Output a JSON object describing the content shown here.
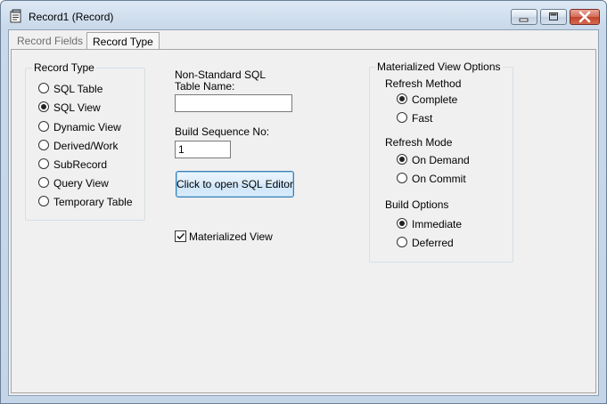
{
  "window": {
    "title": "Record1 (Record)"
  },
  "tabs": [
    {
      "label": "Record Fields",
      "selected": false
    },
    {
      "label": "Record Type",
      "selected": true
    }
  ],
  "record_type": {
    "legend": "Record Type",
    "options": [
      {
        "label": "SQL Table",
        "checked": false
      },
      {
        "label": "SQL View",
        "checked": true
      },
      {
        "label": "Dynamic View",
        "checked": false
      },
      {
        "label": "Derived/Work",
        "checked": false
      },
      {
        "label": "SubRecord",
        "checked": false
      },
      {
        "label": "Query View",
        "checked": false
      },
      {
        "label": "Temporary Table",
        "checked": false
      }
    ]
  },
  "middle": {
    "table_name_label_1": "Non-Standard SQL",
    "table_name_label_2": "Table Name:",
    "table_name_value": "",
    "build_seq_label": "Build Sequence No:",
    "build_seq_value": "1",
    "sql_editor_button": "Click to open SQL Editor",
    "materialized_checkbox": {
      "label": "Materialized View",
      "checked": true
    }
  },
  "mv_options": {
    "legend": "Materialized View Options",
    "refresh_method": {
      "heading": "Refresh Method",
      "options": [
        {
          "label": "Complete",
          "checked": true
        },
        {
          "label": "Fast",
          "checked": false
        }
      ]
    },
    "refresh_mode": {
      "heading": "Refresh Mode",
      "options": [
        {
          "label": "On Demand",
          "checked": true
        },
        {
          "label": "On Commit",
          "checked": false
        }
      ]
    },
    "build_options": {
      "heading": "Build Options",
      "options": [
        {
          "label": "Immediate",
          "checked": true
        },
        {
          "label": "Deferred",
          "checked": false
        }
      ]
    }
  }
}
